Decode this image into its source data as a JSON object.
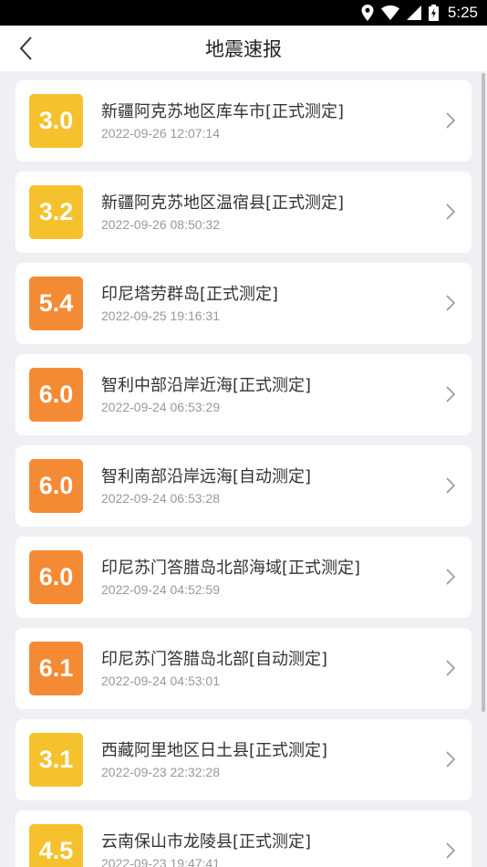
{
  "status_bar": {
    "time": "5:25"
  },
  "header": {
    "title": "地震速报"
  },
  "colors": {
    "low": "#f5c22e",
    "high": "#f58a35"
  },
  "quakes": [
    {
      "magnitude": "3.0",
      "place": "新疆阿克苏地区库车市[正式测定]",
      "time": "2022-09-26 12:07:14",
      "level": "low"
    },
    {
      "magnitude": "3.2",
      "place": "新疆阿克苏地区温宿县[正式测定]",
      "time": "2022-09-26 08:50:32",
      "level": "low"
    },
    {
      "magnitude": "5.4",
      "place": "印尼塔劳群岛[正式测定]",
      "time": "2022-09-25 19:16:31",
      "level": "high"
    },
    {
      "magnitude": "6.0",
      "place": "智利中部沿岸近海[正式测定]",
      "time": "2022-09-24 06:53:29",
      "level": "high"
    },
    {
      "magnitude": "6.0",
      "place": "智利南部沿岸远海[自动测定]",
      "time": "2022-09-24 06:53:28",
      "level": "high"
    },
    {
      "magnitude": "6.0",
      "place": "印尼苏门答腊岛北部海域[正式测定]",
      "time": "2022-09-24 04:52:59",
      "level": "high"
    },
    {
      "magnitude": "6.1",
      "place": "印尼苏门答腊岛北部[自动测定]",
      "time": "2022-09-24 04:53:01",
      "level": "high"
    },
    {
      "magnitude": "3.1",
      "place": "西藏阿里地区日土县[正式测定]",
      "time": "2022-09-23 22:32:28",
      "level": "low"
    },
    {
      "magnitude": "4.5",
      "place": "云南保山市龙陵县[正式测定]",
      "time": "2022-09-23 19:47:41",
      "level": "low"
    }
  ]
}
